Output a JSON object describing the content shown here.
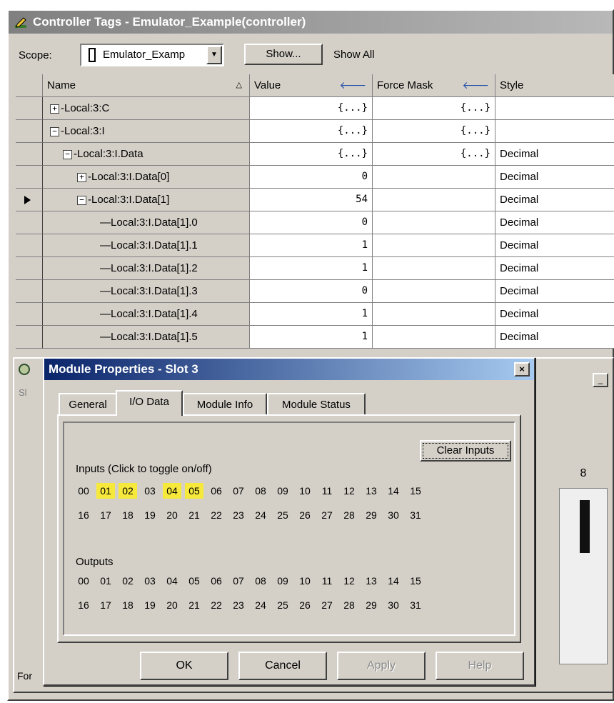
{
  "controller_tags": {
    "title": "Controller Tags - Emulator_Example(controller)",
    "scope_label": "Scope:",
    "scope_value": "Emulator_Examp",
    "show_button": "Show...",
    "show_all": "Show All",
    "columns": {
      "name": "Name",
      "value": "Value",
      "force_mask": "Force Mask",
      "style": "Style"
    },
    "rows": [
      {
        "name": "Local:3:C",
        "expander": "+",
        "value": "{...}",
        "force": "{...}",
        "style": ""
      },
      {
        "name": "Local:3:I",
        "expander": "-",
        "value": "{...}",
        "force": "{...}",
        "style": ""
      },
      {
        "name": "Local:3:I.Data",
        "expander": "-",
        "value": "{...}",
        "force": "{...}",
        "style": "Decimal"
      },
      {
        "name": "Local:3:I.Data[0]",
        "expander": "+",
        "value": "0",
        "force": "",
        "style": "Decimal"
      },
      {
        "name": "Local:3:I.Data[1]",
        "expander": "-",
        "value": "54",
        "force": "",
        "style": "Decimal"
      },
      {
        "name": "Local:3:I.Data[1].0",
        "expander": "",
        "value": "0",
        "force": "",
        "style": "Decimal"
      },
      {
        "name": "Local:3:I.Data[1].1",
        "expander": "",
        "value": "1",
        "force": "",
        "style": "Decimal"
      },
      {
        "name": "Local:3:I.Data[1].2",
        "expander": "",
        "value": "1",
        "force": "",
        "style": "Decimal"
      },
      {
        "name": "Local:3:I.Data[1].3",
        "expander": "",
        "value": "0",
        "force": "",
        "style": "Decimal"
      },
      {
        "name": "Local:3:I.Data[1].4",
        "expander": "",
        "value": "1",
        "force": "",
        "style": "Decimal"
      },
      {
        "name": "Local:3:I.Data[1].5",
        "expander": "",
        "value": "1",
        "force": "",
        "style": "Decimal"
      }
    ],
    "current_row": 4
  },
  "background_window": {
    "slot_label": "Sl",
    "footer_label": "For",
    "module_number": "8"
  },
  "dialog": {
    "title": "Module Properties - Slot 3",
    "close": "×",
    "tabs": [
      "General",
      "I/O Data",
      "Module Info",
      "Module Status"
    ],
    "active_tab": 1,
    "clear_inputs": "Clear Inputs",
    "inputs_label": "Inputs   (Click to toggle on/off)",
    "outputs_label": "Outputs",
    "input_bits": [
      "00",
      "01",
      "02",
      "03",
      "04",
      "05",
      "06",
      "07",
      "08",
      "09",
      "10",
      "11",
      "12",
      "13",
      "14",
      "15",
      "16",
      "17",
      "18",
      "19",
      "20",
      "21",
      "22",
      "23",
      "24",
      "25",
      "26",
      "27",
      "28",
      "29",
      "30",
      "31"
    ],
    "input_bits_on": [
      "01",
      "02",
      "04",
      "05"
    ],
    "output_bits": [
      "00",
      "01",
      "02",
      "03",
      "04",
      "05",
      "06",
      "07",
      "08",
      "09",
      "10",
      "11",
      "12",
      "13",
      "14",
      "15",
      "16",
      "17",
      "18",
      "19",
      "20",
      "21",
      "22",
      "23",
      "24",
      "25",
      "26",
      "27",
      "28",
      "29",
      "30",
      "31"
    ],
    "buttons": {
      "ok": "OK",
      "cancel": "Cancel",
      "apply": "Apply",
      "help": "Help"
    }
  }
}
